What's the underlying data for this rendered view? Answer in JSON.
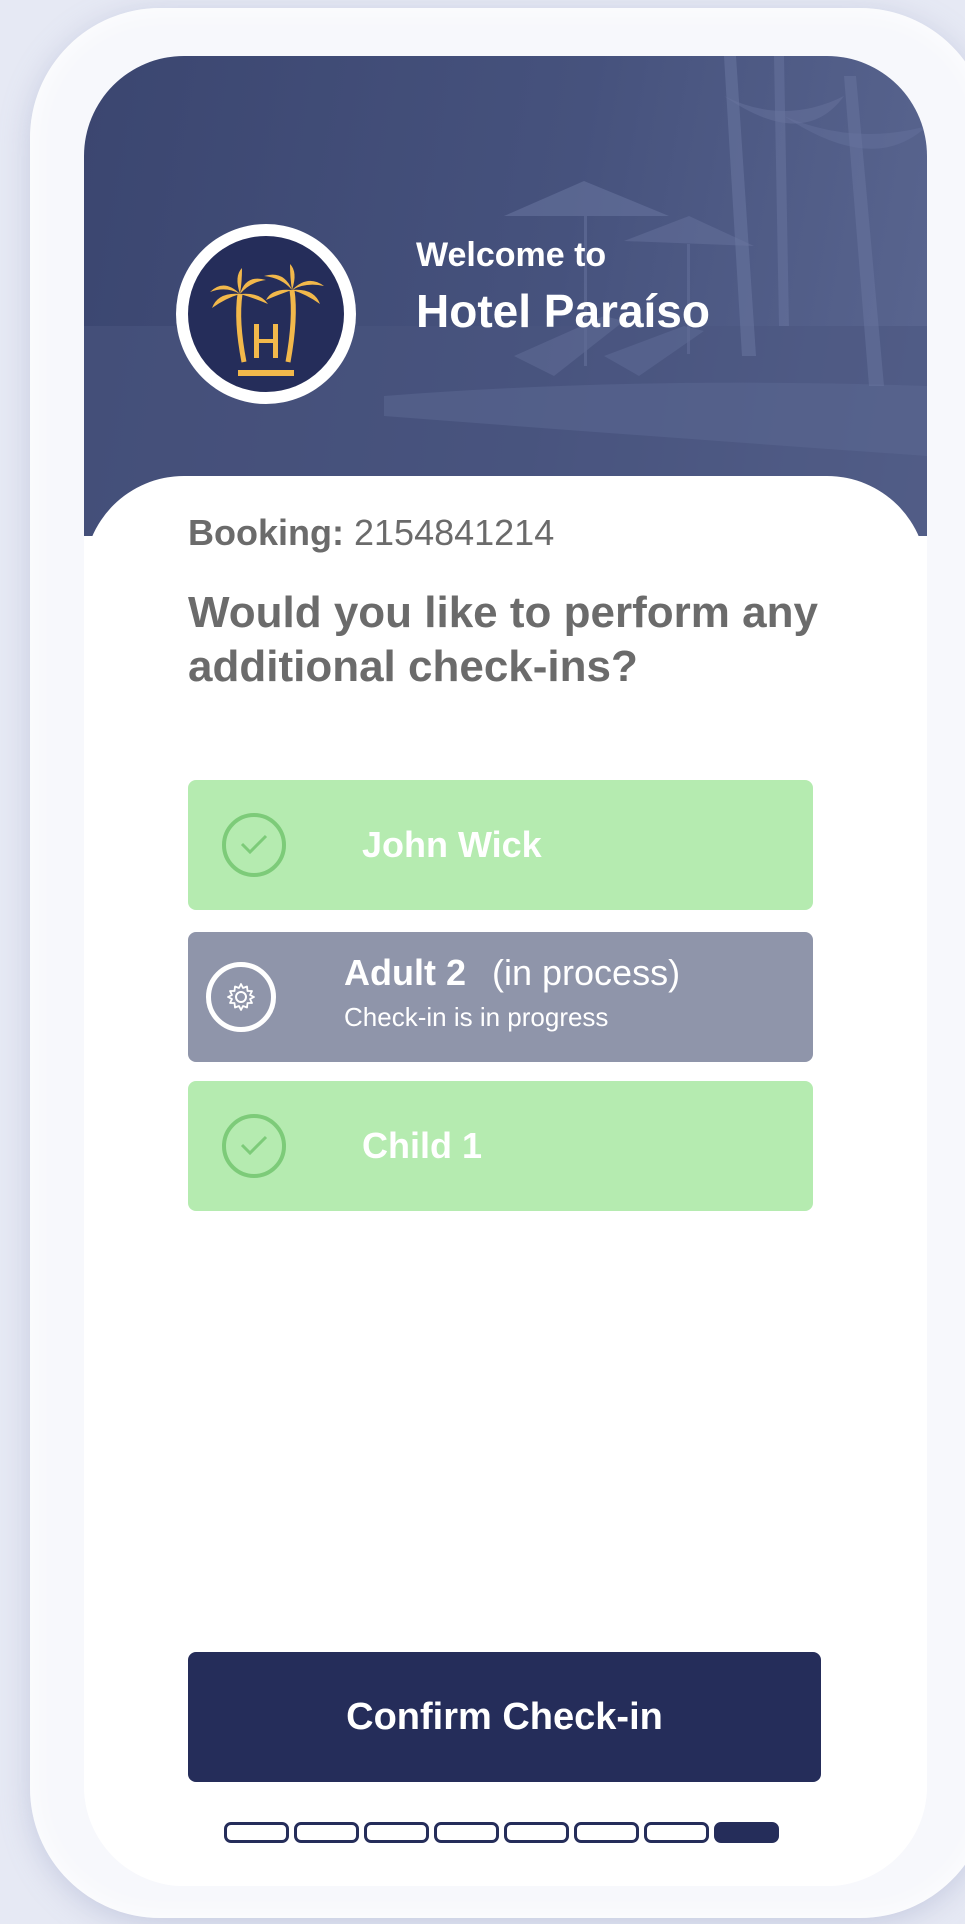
{
  "header": {
    "welcome": "Welcome to",
    "hotel_name": "Hotel Paraíso",
    "logo_letter": "H"
  },
  "booking": {
    "label": "Booking:",
    "number": "2154841214"
  },
  "question": "Would you like to perform any additional check-ins?",
  "guests": [
    {
      "name": "John Wick",
      "status": "completed"
    },
    {
      "name": "Adult 2",
      "status_text": "(in process)",
      "subtitle": "Check-in is in progress",
      "status": "in-progress"
    },
    {
      "name": "Child 1",
      "status": "completed"
    }
  ],
  "confirm_button": "Confirm Check-in",
  "progress_steps": {
    "total": 8,
    "current": 8
  },
  "colors": {
    "header_blue": "#3b4670",
    "navy": "#252d5a",
    "completed_green": "#b5ebb0",
    "check_green": "#7dcb79",
    "in_progress_gray": "#8f95aa",
    "logo_gold": "#f2b84b",
    "text_gray": "#6b6b6b"
  },
  "icons": {
    "completed": "check-icon",
    "in_progress": "gear-icon",
    "logo": "palm-trees-icon"
  }
}
